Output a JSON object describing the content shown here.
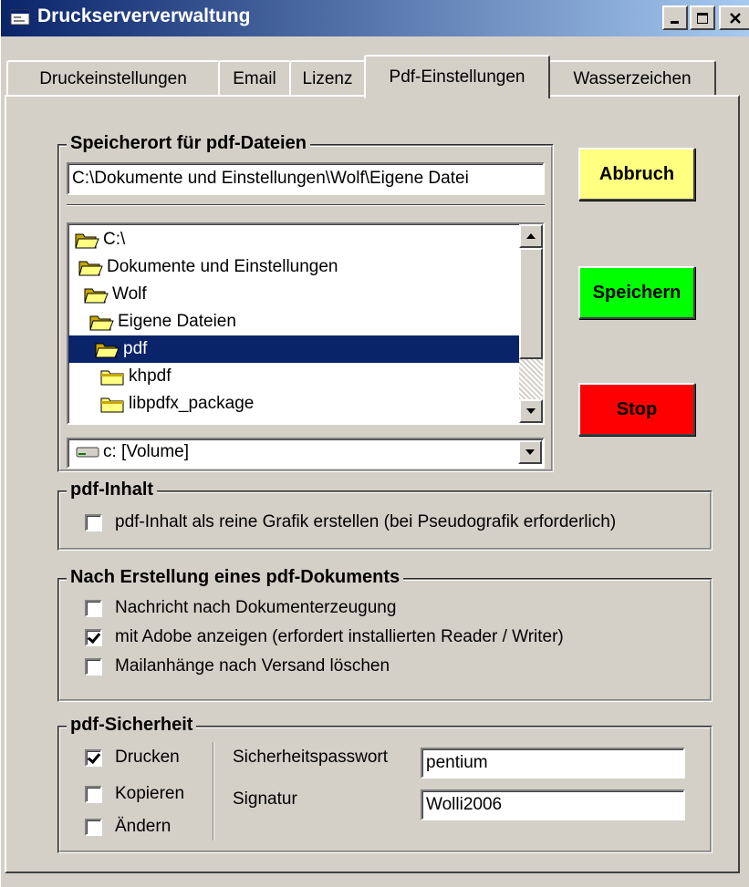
{
  "window": {
    "title": "Druckserververwaltung",
    "minimize_label": "minimize",
    "maximize_label": "maximize",
    "close_label": "close"
  },
  "tabs": [
    {
      "label": "Druckeinstellungen",
      "active": false
    },
    {
      "label": "Email",
      "active": false
    },
    {
      "label": "Lizenz",
      "active": false
    },
    {
      "label": "Pdf-Einstellungen",
      "active": true
    },
    {
      "label": "Wasserzeichen",
      "active": false
    }
  ],
  "speicherort": {
    "title": "Speicherort für pdf-Dateien",
    "path_value": "C:\\Dokumente und Einstellungen\\Wolf\\Eigene Datei",
    "folders": [
      {
        "name": "C:\\",
        "open": true,
        "selected": false
      },
      {
        "name": "Dokumente und Einstellungen",
        "open": true,
        "selected": false
      },
      {
        "name": "Wolf",
        "open": true,
        "selected": false
      },
      {
        "name": "Eigene Dateien",
        "open": true,
        "selected": false
      },
      {
        "name": "pdf",
        "open": true,
        "selected": true
      },
      {
        "name": "khpdf",
        "open": false,
        "selected": false
      },
      {
        "name": "libpdfx_package",
        "open": false,
        "selected": false
      }
    ],
    "drive": "c: [Volume]"
  },
  "buttons": {
    "abbruch": "Abbruch",
    "speichern": "Speichern",
    "stop": "Stop"
  },
  "pdf_inhalt": {
    "title": "pdf-Inhalt",
    "grafik_label": "pdf-Inhalt als reine Grafik erstellen (bei Pseudografik erforderlich)",
    "grafik_checked": false
  },
  "nach_erstellung": {
    "title": "Nach Erstellung eines pdf-Dokuments",
    "options": [
      {
        "label": "Nachricht nach Dokumenterzeugung",
        "checked": false
      },
      {
        "label": "mit Adobe anzeigen (erfordert installierten Reader / Writer)",
        "checked": true
      },
      {
        "label": "Mailanhänge nach Versand löschen",
        "checked": false
      }
    ]
  },
  "sicherheit": {
    "title": "pdf-Sicherheit",
    "drucken": "Drucken",
    "drucken_checked": true,
    "kopieren": "Kopieren",
    "kopieren_checked": false,
    "aendern": "Ändern",
    "aendern_checked": false,
    "passwort_label": "Sicherheitspasswort",
    "passwort_value": "pentium",
    "signatur_label": "Signatur",
    "signatur_value": "Wolli2006"
  },
  "colors": {
    "abbruch_bg": "#ffff80",
    "speichern_bg": "#00ff00",
    "stop_bg": "#ff0000",
    "titlebar": "#0a246a",
    "selection": "#0a246a"
  }
}
